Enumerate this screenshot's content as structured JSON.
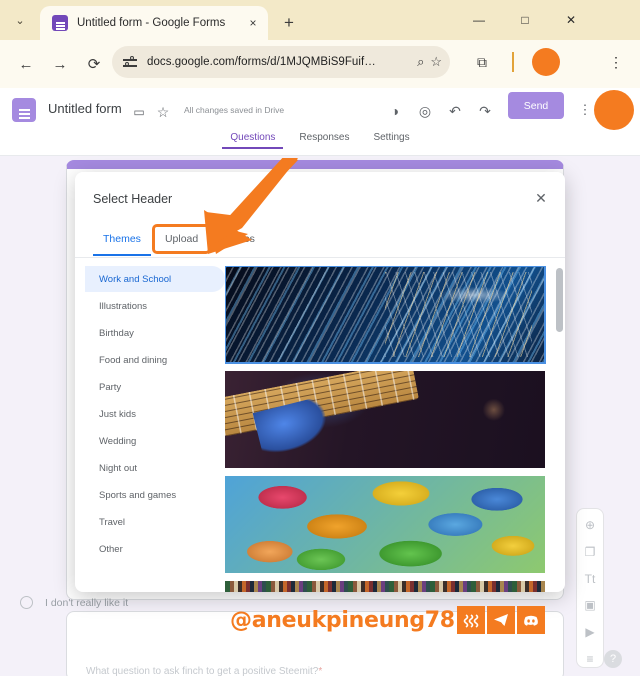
{
  "browser": {
    "tab": {
      "title": "Untitled form - Google Forms",
      "favicon": "forms-favicon",
      "close": "×"
    },
    "tab_search": "⌄",
    "new_tab": "+",
    "window_controls": {
      "minimize": "—",
      "maximize": "□",
      "close": "✕"
    },
    "nav": {
      "back": "←",
      "forward": "→",
      "reload": "⟳"
    },
    "omnibox": {
      "url": "docs.google.com/forms/d/1MJQMBiS9Fuif…",
      "site_settings_icon": "tune-icon",
      "zoom_icon": "⌕",
      "bookmark_icon": "☆"
    },
    "extensions_icon": "⧉",
    "profile_avatar_color": "#f47b20",
    "menu_icon": "⋮"
  },
  "app": {
    "logo": "google-forms-logo",
    "title": "Untitled form",
    "folder_icon": "▭",
    "star_icon": "☆",
    "save_status": "All changes saved in Drive",
    "toolbar": {
      "theme_icon": "◑",
      "preview_icon": "◎",
      "undo_icon": "↶",
      "redo_icon": "↷",
      "send_label": "Send",
      "more_icon": "⋮"
    },
    "avatar_color": "#f47b20",
    "tabs": [
      {
        "label": "Questions",
        "active": true
      },
      {
        "label": "Responses",
        "active": false
      },
      {
        "label": "Settings",
        "active": false
      }
    ],
    "accent_color": "#7248b9"
  },
  "form_behind": {
    "radio_option": "I don't really like it",
    "next_question_partial": "What question to ask finch to get a positive Steemit?",
    "required_marker": "*"
  },
  "float_toolbar": {
    "items": [
      {
        "name": "add-question-icon",
        "glyph": "⊕"
      },
      {
        "name": "import-questions-icon",
        "glyph": "❐"
      },
      {
        "name": "add-title-icon",
        "glyph": "Tt"
      },
      {
        "name": "add-image-icon",
        "glyph": "▣"
      },
      {
        "name": "add-video-icon",
        "glyph": "▶"
      },
      {
        "name": "add-section-icon",
        "glyph": "≡"
      }
    ],
    "help_label": "?"
  },
  "dialog": {
    "title": "Select Header",
    "close_icon": "✕",
    "tabs": [
      {
        "label": "Themes",
        "active": true,
        "highlighted": false
      },
      {
        "label": "Upload",
        "active": false,
        "highlighted": true
      },
      {
        "label": "Photos",
        "active": false,
        "highlighted": false
      }
    ],
    "categories": [
      {
        "label": "Work and School",
        "active": true
      },
      {
        "label": "Illustrations",
        "active": false
      },
      {
        "label": "Birthday",
        "active": false
      },
      {
        "label": "Food and dining",
        "active": false
      },
      {
        "label": "Party",
        "active": false
      },
      {
        "label": "Just kids",
        "active": false
      },
      {
        "label": "Wedding",
        "active": false
      },
      {
        "label": "Night out",
        "active": false
      },
      {
        "label": "Sports and games",
        "active": false
      },
      {
        "label": "Travel",
        "active": false
      },
      {
        "label": "Other",
        "active": false
      }
    ],
    "thumbnails": [
      {
        "name": "header-thumb-tech-lights",
        "selected": true
      },
      {
        "name": "header-thumb-guitar",
        "selected": false
      },
      {
        "name": "header-thumb-candy",
        "selected": false
      },
      {
        "name": "header-thumb-threads",
        "selected": false
      }
    ],
    "active_tab_color": "#1a73e8",
    "highlight_color": "#f47b20"
  },
  "annotation": {
    "arrow_color": "#f47b20",
    "arrow_target": "upload-tab",
    "watermark_text": "@aneukpineung78",
    "badges": [
      {
        "name": "steemit-badge",
        "glyph": "≈"
      },
      {
        "name": "telegram-badge",
        "glyph": "➤"
      },
      {
        "name": "discord-badge",
        "glyph": "◉"
      }
    ]
  }
}
